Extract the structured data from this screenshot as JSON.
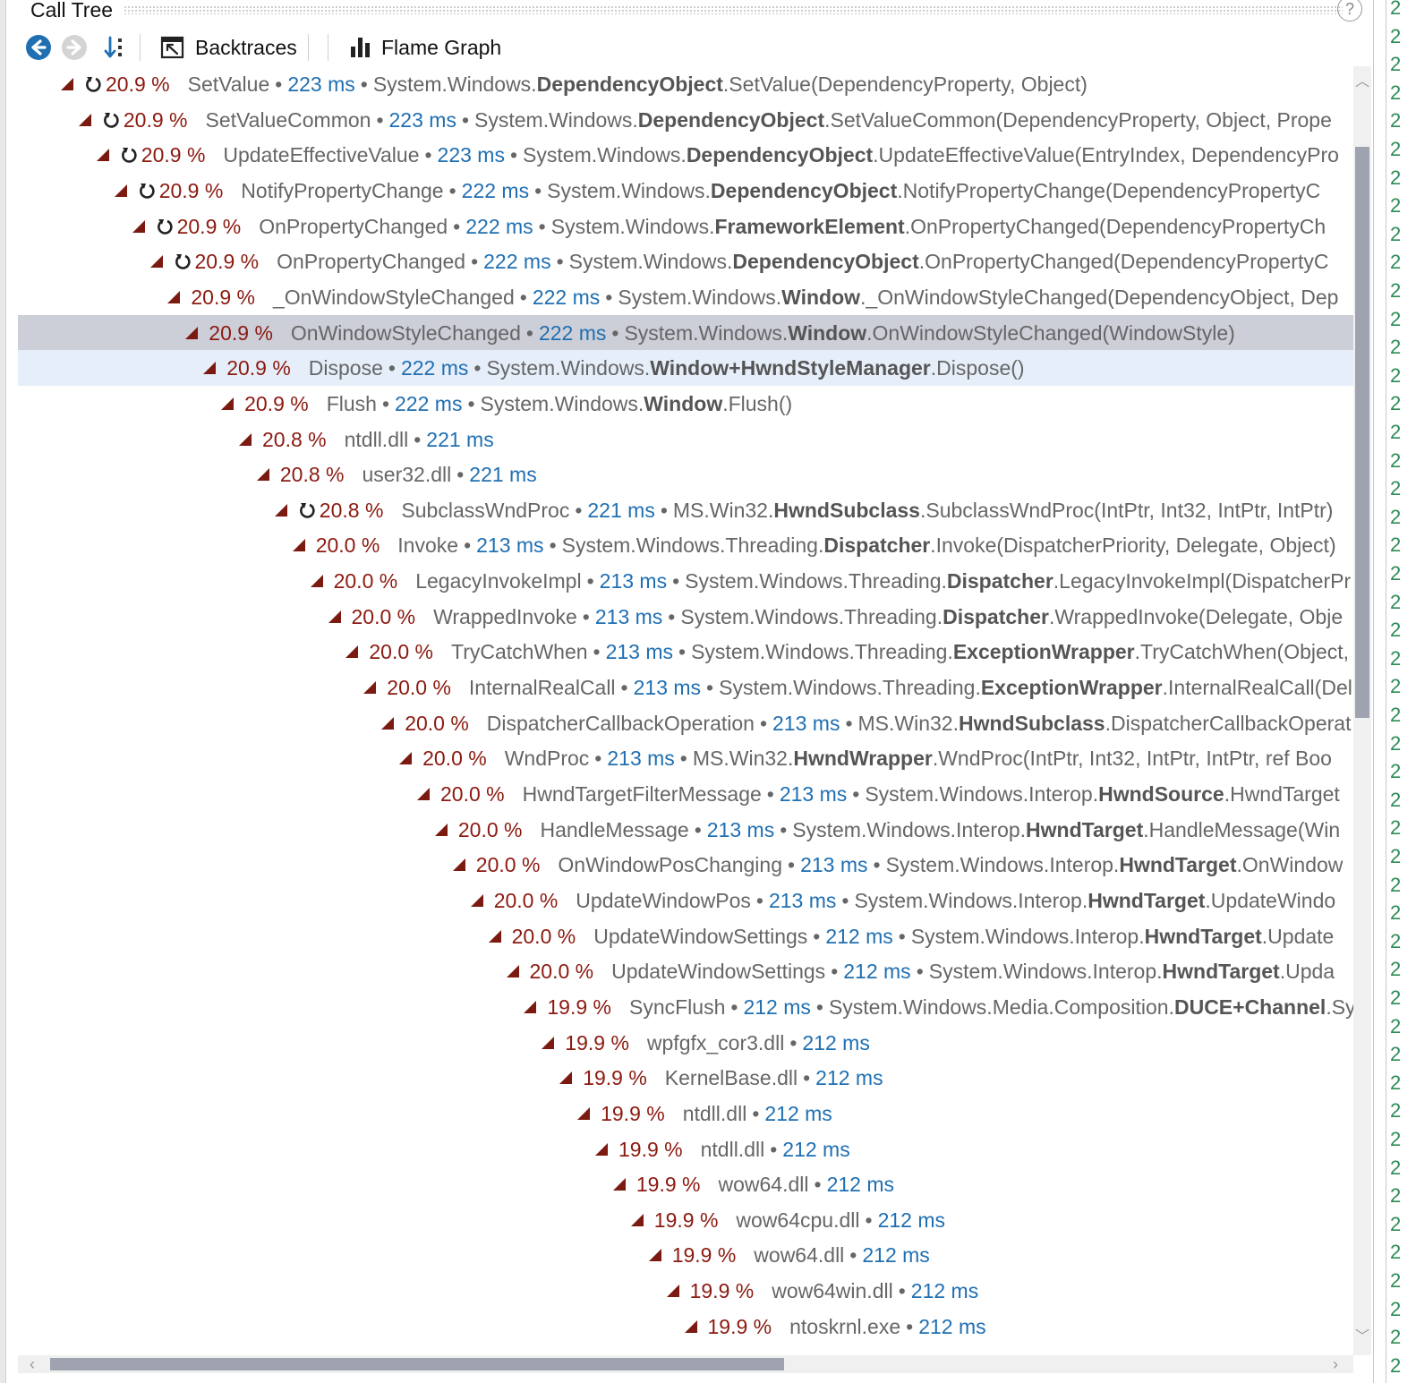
{
  "panel": {
    "title": "Call Tree",
    "help_glyph": "?"
  },
  "toolbar": {
    "back_icon": "back-arrow-icon",
    "forward_icon": "forward-arrow-icon",
    "sort_icon": "sort-descending-icon",
    "backtraces_label": "Backtraces",
    "flamegraph_label": "Flame Graph"
  },
  "colors": {
    "percent": "#8b1a10",
    "time": "#1f6fb2",
    "selected_row": "#ccced8",
    "hover_row": "#e6eef9",
    "strip_text": "#2e8b57"
  },
  "rows": [
    {
      "depth": 0,
      "recursive": true,
      "percent": "20.9 %",
      "name": "SetValue",
      "time": "223 ms",
      "ns": "System.Windows.",
      "cls": "DependencyObject",
      "sig": ".SetValue(DependencyProperty, Object)"
    },
    {
      "depth": 1,
      "recursive": true,
      "percent": "20.9 %",
      "name": "SetValueCommon",
      "time": "223 ms",
      "ns": "System.Windows.",
      "cls": "DependencyObject",
      "sig": ".SetValueCommon(DependencyProperty, Object, Prope"
    },
    {
      "depth": 2,
      "recursive": true,
      "percent": "20.9 %",
      "name": "UpdateEffectiveValue",
      "time": "223 ms",
      "ns": "System.Windows.",
      "cls": "DependencyObject",
      "sig": ".UpdateEffectiveValue(EntryIndex, DependencyPro"
    },
    {
      "depth": 3,
      "recursive": true,
      "percent": "20.9 %",
      "name": "NotifyPropertyChange",
      "time": "222 ms",
      "ns": "System.Windows.",
      "cls": "DependencyObject",
      "sig": ".NotifyPropertyChange(DependencyPropertyC"
    },
    {
      "depth": 4,
      "recursive": true,
      "percent": "20.9 %",
      "name": "OnPropertyChanged",
      "time": "222 ms",
      "ns": "System.Windows.",
      "cls": "FrameworkElement",
      "sig": ".OnPropertyChanged(DependencyPropertyCh"
    },
    {
      "depth": 5,
      "recursive": true,
      "percent": "20.9 %",
      "name": "OnPropertyChanged",
      "time": "222 ms",
      "ns": "System.Windows.",
      "cls": "DependencyObject",
      "sig": ".OnPropertyChanged(DependencyPropertyC"
    },
    {
      "depth": 6,
      "recursive": false,
      "percent": "20.9 %",
      "name": "_OnWindowStyleChanged",
      "time": "222 ms",
      "ns": "System.Windows.",
      "cls": "Window",
      "sig": "._OnWindowStyleChanged(DependencyObject, Dep"
    },
    {
      "depth": 7,
      "recursive": false,
      "percent": "20.9 %",
      "name": "OnWindowStyleChanged",
      "time": "222 ms",
      "ns": "System.Windows.",
      "cls": "Window",
      "sig": ".OnWindowStyleChanged(WindowStyle)",
      "state": "selected"
    },
    {
      "depth": 8,
      "recursive": false,
      "percent": "20.9 %",
      "name": "Dispose",
      "time": "222 ms",
      "ns": "System.Windows.",
      "cls": "Window+HwndStyleManager",
      "sig": ".Dispose()",
      "state": "hover"
    },
    {
      "depth": 9,
      "recursive": false,
      "percent": "20.9 %",
      "name": "Flush",
      "time": "222 ms",
      "ns": "System.Windows.",
      "cls": "Window",
      "sig": ".Flush()"
    },
    {
      "depth": 10,
      "recursive": false,
      "percent": "20.8 %",
      "name": "ntdll.dll",
      "time": "221 ms"
    },
    {
      "depth": 11,
      "recursive": false,
      "percent": "20.8 %",
      "name": "user32.dll",
      "time": "221 ms"
    },
    {
      "depth": 12,
      "recursive": true,
      "percent": "20.8 %",
      "name": "SubclassWndProc",
      "time": "221 ms",
      "ns": "MS.Win32.",
      "cls": "HwndSubclass",
      "sig": ".SubclassWndProc(IntPtr, Int32, IntPtr, IntPtr)"
    },
    {
      "depth": 13,
      "recursive": false,
      "percent": "20.0 %",
      "name": "Invoke",
      "time": "213 ms",
      "ns": "System.Windows.Threading.",
      "cls": "Dispatcher",
      "sig": ".Invoke(DispatcherPriority, Delegate, Object)"
    },
    {
      "depth": 14,
      "recursive": false,
      "percent": "20.0 %",
      "name": "LegacyInvokeImpl",
      "time": "213 ms",
      "ns": "System.Windows.Threading.",
      "cls": "Dispatcher",
      "sig": ".LegacyInvokeImpl(DispatcherPr"
    },
    {
      "depth": 15,
      "recursive": false,
      "percent": "20.0 %",
      "name": "WrappedInvoke",
      "time": "213 ms",
      "ns": "System.Windows.Threading.",
      "cls": "Dispatcher",
      "sig": ".WrappedInvoke(Delegate, Obje"
    },
    {
      "depth": 16,
      "recursive": false,
      "percent": "20.0 %",
      "name": "TryCatchWhen",
      "time": "213 ms",
      "ns": "System.Windows.Threading.",
      "cls": "ExceptionWrapper",
      "sig": ".TryCatchWhen(Object,"
    },
    {
      "depth": 17,
      "recursive": false,
      "percent": "20.0 %",
      "name": "InternalRealCall",
      "time": "213 ms",
      "ns": "System.Windows.Threading.",
      "cls": "ExceptionWrapper",
      "sig": ".InternalRealCall(Del"
    },
    {
      "depth": 18,
      "recursive": false,
      "percent": "20.0 %",
      "name": "DispatcherCallbackOperation",
      "time": "213 ms",
      "ns": "MS.Win32.",
      "cls": "HwndSubclass",
      "sig": ".DispatcherCallbackOperat"
    },
    {
      "depth": 19,
      "recursive": false,
      "percent": "20.0 %",
      "name": "WndProc",
      "time": "213 ms",
      "ns": "MS.Win32.",
      "cls": "HwndWrapper",
      "sig": ".WndProc(IntPtr, Int32, IntPtr, IntPtr, ref Boo"
    },
    {
      "depth": 20,
      "recursive": false,
      "percent": "20.0 %",
      "name": "HwndTargetFilterMessage",
      "time": "213 ms",
      "ns": "System.Windows.Interop.",
      "cls": "HwndSource",
      "sig": ".HwndTarget"
    },
    {
      "depth": 21,
      "recursive": false,
      "percent": "20.0 %",
      "name": "HandleMessage",
      "time": "213 ms",
      "ns": "System.Windows.Interop.",
      "cls": "HwndTarget",
      "sig": ".HandleMessage(Win"
    },
    {
      "depth": 22,
      "recursive": false,
      "percent": "20.0 %",
      "name": "OnWindowPosChanging",
      "time": "213 ms",
      "ns": "System.Windows.Interop.",
      "cls": "HwndTarget",
      "sig": ".OnWindow"
    },
    {
      "depth": 23,
      "recursive": false,
      "percent": "20.0 %",
      "name": "UpdateWindowPos",
      "time": "213 ms",
      "ns": "System.Windows.Interop.",
      "cls": "HwndTarget",
      "sig": ".UpdateWindo"
    },
    {
      "depth": 24,
      "recursive": false,
      "percent": "20.0 %",
      "name": "UpdateWindowSettings",
      "time": "212 ms",
      "ns": "System.Windows.Interop.",
      "cls": "HwndTarget",
      "sig": ".Update"
    },
    {
      "depth": 25,
      "recursive": false,
      "percent": "20.0 %",
      "name": "UpdateWindowSettings",
      "time": "212 ms",
      "ns": "System.Windows.Interop.",
      "cls": "HwndTarget",
      "sig": ".Upda"
    },
    {
      "depth": 26,
      "recursive": false,
      "percent": "19.9 %",
      "name": "SyncFlush",
      "time": "212 ms",
      "ns": "System.Windows.Media.Composition.",
      "cls": "DUCE+Channel",
      "sig": ".Sy"
    },
    {
      "depth": 27,
      "recursive": false,
      "percent": "19.9 %",
      "name": "wpfgfx_cor3.dll",
      "time": "212 ms"
    },
    {
      "depth": 28,
      "recursive": false,
      "percent": "19.9 %",
      "name": "KernelBase.dll",
      "time": "212 ms"
    },
    {
      "depth": 29,
      "recursive": false,
      "percent": "19.9 %",
      "name": "ntdll.dll",
      "time": "212 ms"
    },
    {
      "depth": 30,
      "recursive": false,
      "percent": "19.9 %",
      "name": "ntdll.dll",
      "time": "212 ms"
    },
    {
      "depth": 31,
      "recursive": false,
      "percent": "19.9 %",
      "name": "wow64.dll",
      "time": "212 ms"
    },
    {
      "depth": 32,
      "recursive": false,
      "percent": "19.9 %",
      "name": "wow64cpu.dll",
      "time": "212 ms"
    },
    {
      "depth": 33,
      "recursive": false,
      "percent": "19.9 %",
      "name": "wow64.dll",
      "time": "212 ms"
    },
    {
      "depth": 34,
      "recursive": false,
      "percent": "19.9 %",
      "name": "wow64win.dll",
      "time": "212 ms"
    },
    {
      "depth": 35,
      "recursive": false,
      "percent": "19.9 %",
      "name": "ntoskrnl.exe",
      "time": "212 ms"
    }
  ],
  "right_strip_char": "2"
}
